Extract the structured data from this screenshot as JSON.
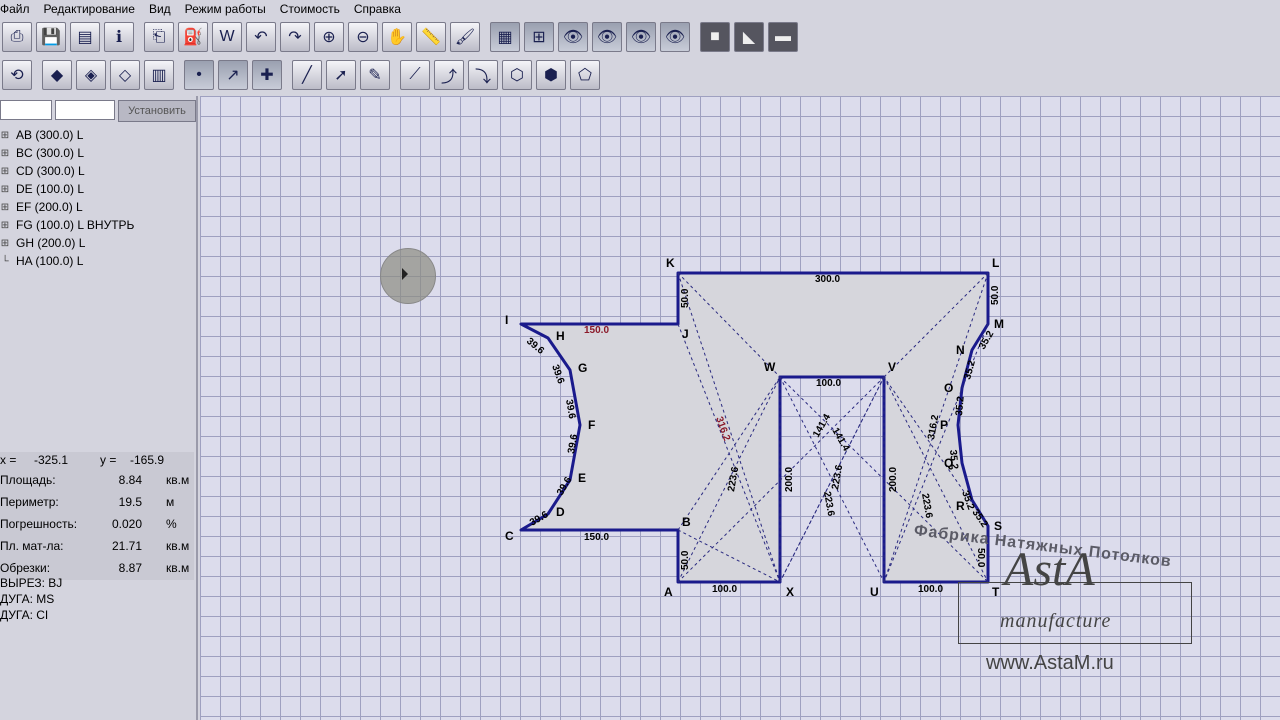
{
  "menu": [
    "Файл",
    "Редактирование",
    "Вид",
    "Режим работы",
    "Стоимость",
    "Справка"
  ],
  "toolbar": {
    "row1": [
      "new-icon",
      "save-icon",
      "open-icon",
      "info-icon",
      "properties-icon",
      "paint-bucket-icon",
      "w-icon",
      "undo-icon",
      "redo-icon",
      "zoom-in-icon",
      "zoom-out-icon",
      "hand-icon",
      "ruler-icon",
      "brush-icon",
      "grid-icon",
      "grid-snap-icon",
      "eye-icon",
      "monitor-eye-icon",
      "eye-off-icon",
      "eye-edit-icon",
      "fill-square-icon",
      "corner-icon",
      "line-icon"
    ],
    "row2": [
      "rotate-90-icon",
      "diamond-icon",
      "diamond-down-icon",
      "diamond-outline-icon",
      "layers-icon",
      "node-point-icon",
      "node-edit-icon",
      "node-add-icon",
      "line-tool-icon",
      "arrow-tool-icon",
      "pen-tool-icon",
      "shape-1-icon",
      "shape-2-icon",
      "shape-3-icon",
      "shape-4-icon",
      "shape-5-icon",
      "shape-6-icon"
    ],
    "row1_glyphs": [
      "⎙",
      "💾",
      "▤",
      "ℹ",
      "⎗",
      "⛽",
      "W",
      "↶",
      "↷",
      "⊕",
      "⊖",
      "✋",
      "📏",
      "🖌",
      "▦",
      "⊞",
      "👁",
      "👁",
      "👁",
      "👁",
      "■",
      "◣",
      "▬"
    ],
    "row2_glyphs": [
      "⟲",
      "◆",
      "◈",
      "◇",
      "▥",
      "•",
      "↗",
      "✚",
      "╱",
      "➚",
      "✎",
      "⟋",
      "⤴",
      "⤵",
      "⬡",
      "⬢",
      "⬠"
    ]
  },
  "left_panel": {
    "input1": "",
    "input2": "",
    "set_button": "Установить",
    "tree": [
      {
        "label": "AB (300.0) L",
        "expander": "⊞"
      },
      {
        "label": "BC (300.0) L",
        "expander": "⊞"
      },
      {
        "label": "CD (300.0) L",
        "expander": "⊞"
      },
      {
        "label": "DE (100.0) L",
        "expander": "⊞"
      },
      {
        "label": "EF (200.0) L",
        "expander": "⊞"
      },
      {
        "label": "FG (100.0) L ВНУТРЬ",
        "expander": "⊞"
      },
      {
        "label": "GH (200.0) L",
        "expander": "⊞"
      },
      {
        "label": "HA (100.0) L",
        "expander": "└"
      }
    ],
    "coords": {
      "x_label": "x =",
      "x_value": "-325.1",
      "y_label": "y =",
      "y_value": "-165.9"
    },
    "stats": [
      {
        "label": "Площадь:",
        "value": "8.84",
        "unit": "кв.м"
      },
      {
        "label": "Периметр:",
        "value": "19.5",
        "unit": "м"
      },
      {
        "label": "Погрешность:",
        "value": "0.020",
        "unit": "%"
      },
      {
        "label": "Пл. мат-ла:",
        "value": "21.71",
        "unit": "кв.м"
      },
      {
        "label": "Обрезки:",
        "value": "8.87",
        "unit": "кв.м"
      }
    ],
    "cuts": [
      "ВЫРЕЗ: BJ",
      "ДУГА: MS",
      "ДУГА: CI"
    ]
  },
  "drawing": {
    "vertices": [
      {
        "name": "K"
      },
      {
        "name": "L"
      },
      {
        "name": "M"
      },
      {
        "name": "N"
      },
      {
        "name": "O"
      },
      {
        "name": "P"
      },
      {
        "name": "Q"
      },
      {
        "name": "R"
      },
      {
        "name": "S"
      },
      {
        "name": "T"
      },
      {
        "name": "U"
      },
      {
        "name": "V"
      },
      {
        "name": "W"
      },
      {
        "name": "X"
      },
      {
        "name": "A"
      },
      {
        "name": "B"
      },
      {
        "name": "C"
      },
      {
        "name": "D"
      },
      {
        "name": "E"
      },
      {
        "name": "F"
      },
      {
        "name": "G"
      },
      {
        "name": "H"
      },
      {
        "name": "I"
      },
      {
        "name": "J"
      }
    ],
    "dimensions": {
      "kl": "300.0",
      "lm": "50.0",
      "ij": "150.0",
      "bc": "150.0",
      "wv": "100.0",
      "ax": "100.0",
      "ut": "100.0",
      "kj": "50.0",
      "ab": "50.0",
      "wx": "200.0",
      "vu": "200.0",
      "diag_left": "316.2",
      "diag_left2": "223.6",
      "diag_right": "316.2",
      "diag_right2": "223.6",
      "center1": "141.4",
      "center2": "141.4",
      "center3": "223.6",
      "center4": "223.6",
      "arc_ih": "39.6",
      "arc_hg": "39.6",
      "arc_gf": "39.6",
      "arc_fe": "39.6",
      "arc_ed": "39.6",
      "arc_dc": "39.6",
      "arc_mn": "35.2",
      "arc_no": "35.2",
      "arc_op": "35.2",
      "arc_pq": "35.2",
      "arc_qr": "35.2",
      "arc_rs": "35.2",
      "st": "50.0"
    }
  },
  "watermark": {
    "company": "Фабрика Натяжных Потолков",
    "brand": "AstA",
    "sub": "manufacture",
    "url": "www.AstaM.ru"
  },
  "colors": {
    "outline": "#1a1a8c",
    "fill": "#d6d6dc",
    "grid": "#9fa0c0",
    "red_dim": "#8b1a2a"
  }
}
